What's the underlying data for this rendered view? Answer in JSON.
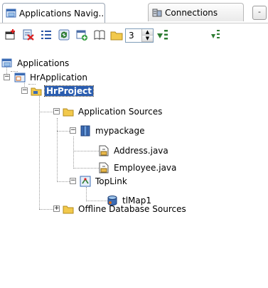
{
  "tabs": [
    {
      "label": "Applications Navig...",
      "icon": "applications-icon",
      "active": true
    },
    {
      "label": "Connections",
      "icon": "connections-icon",
      "active": false
    }
  ],
  "tab_overflow_label": "-",
  "toolbar": {
    "buttons": [
      {
        "icon": "new-application-icon"
      },
      {
        "icon": "delete-icon"
      },
      {
        "icon": "properties-icon"
      },
      {
        "icon": "refresh-icon"
      },
      {
        "icon": "add-to-project-icon"
      },
      {
        "icon": "library-icon"
      },
      {
        "icon": "folder-icon"
      }
    ],
    "level_value": "3",
    "filter_icon": "sort-filter-icon"
  },
  "tree": {
    "nodes": [
      {
        "label": "Applications",
        "icon": "applications-icon"
      },
      {
        "label": "HrApplication",
        "icon": "application-icon"
      },
      {
        "label": "HrProject",
        "icon": "project-folder-icon",
        "selected": true
      },
      {
        "label": "Application Sources",
        "icon": "folder-icon"
      },
      {
        "label": "mypackage",
        "icon": "package-icon"
      },
      {
        "label": "Address.java",
        "icon": "java-file-icon"
      },
      {
        "label": "Employee.java",
        "icon": "java-file-icon"
      },
      {
        "label": "TopLink",
        "icon": "toplink-icon"
      },
      {
        "label": "tlMap1",
        "icon": "toplink-map-icon"
      },
      {
        "label": "Offline Database Sources",
        "icon": "folder-icon"
      }
    ]
  },
  "colors": {
    "selection": "#2a5db0",
    "folder": "#f2c94c",
    "border": "#b8b8b8"
  }
}
